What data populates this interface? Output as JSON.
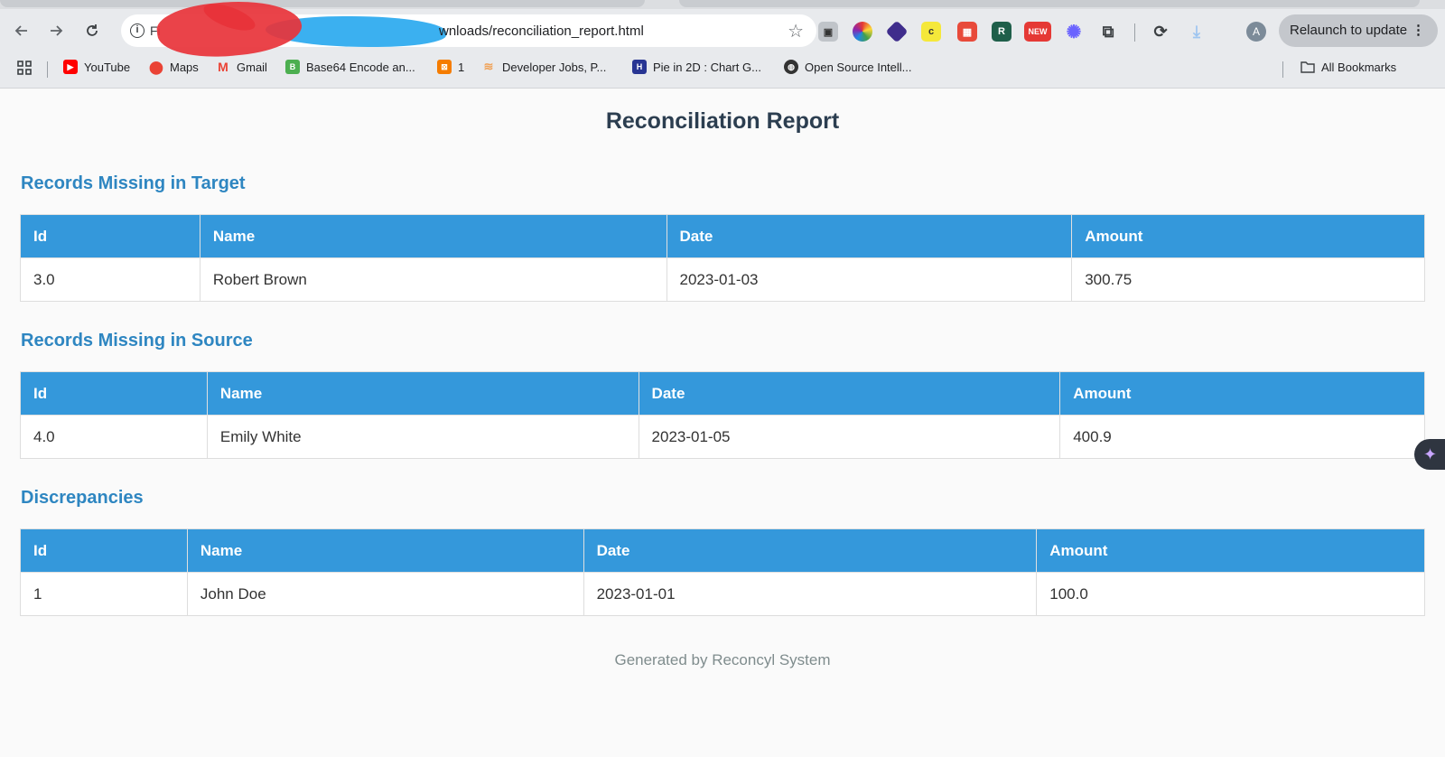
{
  "browser": {
    "url_scheme": "Fi",
    "url_visible": "wnloads/reconciliation_report.html",
    "relaunch_label": "Relaunch to update",
    "relaunch_menu": "⋮",
    "avatar_letter": "A",
    "new_badge": "NEW",
    "bookmarks": [
      {
        "label": "YouTube",
        "icon": "youtube-icon"
      },
      {
        "label": "Maps",
        "icon": "maps-icon"
      },
      {
        "label": "Gmail",
        "icon": "gmail-icon"
      },
      {
        "label": "Base64 Encode an...",
        "icon": "base64-icon"
      },
      {
        "label": "1",
        "icon": "bookmark-1-icon"
      },
      {
        "label": "Developer Jobs, P...",
        "icon": "developer-jobs-icon"
      },
      {
        "label": "Pie in 2D : Chart G...",
        "icon": "chart-icon"
      },
      {
        "label": "Open Source Intell...",
        "icon": "globe-icon"
      }
    ],
    "all_bookmarks": "All Bookmarks"
  },
  "report": {
    "title": "Reconciliation Report",
    "columns": [
      "Id",
      "Name",
      "Date",
      "Amount"
    ],
    "sections": [
      {
        "title": "Records Missing in Target",
        "rows": [
          [
            "3.0",
            "Robert Brown",
            "2023-01-03",
            "300.75"
          ]
        ]
      },
      {
        "title": "Records Missing in Source",
        "rows": [
          [
            "4.0",
            "Emily White",
            "2023-01-05",
            "400.9"
          ]
        ]
      },
      {
        "title": "Discrepancies",
        "rows": [
          [
            "1",
            "John Doe",
            "2023-01-01",
            "100.0"
          ]
        ]
      }
    ],
    "footer": "Generated by Reconcyl System"
  },
  "colors": {
    "header_bg": "#3498db",
    "section_title": "#2e86c1",
    "report_title": "#2c3e50"
  }
}
